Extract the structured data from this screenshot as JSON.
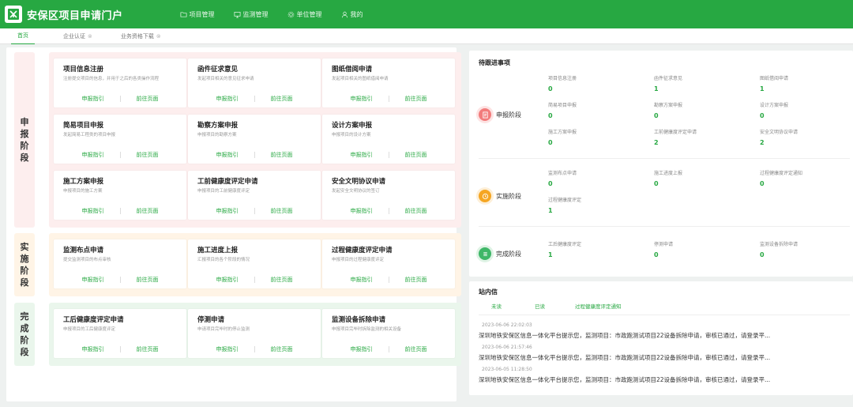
{
  "header": {
    "title": "安保区项目申请门户",
    "nav": [
      {
        "label": "项目管理",
        "icon": "folder-icon"
      },
      {
        "label": "监测管理",
        "icon": "monitor-icon"
      },
      {
        "label": "单位管理",
        "icon": "gear-icon"
      },
      {
        "label": "我的",
        "icon": "user-icon"
      }
    ]
  },
  "tabs": [
    {
      "label": "首页",
      "active": true
    },
    {
      "label": "企业认证",
      "active": false
    },
    {
      "label": "业务资格下载",
      "active": false
    }
  ],
  "card_actions": {
    "guide": "申报指引",
    "go": "前往页面"
  },
  "stages": [
    {
      "label": [
        "申",
        "报",
        "阶",
        "段"
      ],
      "cards": [
        {
          "title": "项目信息注册",
          "desc": "注册提交项目的信息，并用于之后的各类操作流程"
        },
        {
          "title": "函件征求意见",
          "desc": "发起项目相关的意见征求申请"
        },
        {
          "title": "图纸借阅申请",
          "desc": "发起项目相关的图纸借阅申请"
        },
        {
          "title": "简易项目申报",
          "desc": "发起简易工程类的项目申报"
        },
        {
          "title": "勘察方案申报",
          "desc": "申报项目的勘察方案"
        },
        {
          "title": "设计方案申报",
          "desc": "申报项目的设计方案"
        },
        {
          "title": "施工方案申报",
          "desc": "申报项目的施工方案"
        },
        {
          "title": "工前健康度评定申请",
          "desc": "申报项目的工前健康度评定"
        },
        {
          "title": "安全文明协议申请",
          "desc": "发起安全文明协议的签订"
        }
      ]
    },
    {
      "label": [
        "实",
        "施",
        "阶",
        "段"
      ],
      "cards": [
        {
          "title": "监测布点申请",
          "desc": "提交监测项目的布点审核"
        },
        {
          "title": "施工进度上报",
          "desc": "汇报项目的各个阶段的情况"
        },
        {
          "title": "过程健康度评定申请",
          "desc": "申报项目的过程健康度评定"
        }
      ]
    },
    {
      "label": [
        "完",
        "成",
        "阶",
        "段"
      ],
      "cards": [
        {
          "title": "工后健康度评定申请",
          "desc": "申报项目的工后健康度评定"
        },
        {
          "title": "停测申请",
          "desc": "申请项目完毕时的停止监测"
        },
        {
          "title": "监测设备拆除申请",
          "desc": "申报项目完毕时拆除监测的相关设备"
        }
      ]
    }
  ],
  "pending": {
    "title": "待跟进事项",
    "phases": [
      {
        "label": "申报阶段",
        "color": "#f27c7c",
        "bg": "#fde3e3",
        "items": [
          {
            "label": "项目信息注册",
            "value": "0"
          },
          {
            "label": "函件征求意见",
            "value": "1"
          },
          {
            "label": "图纸借阅申请",
            "value": "1"
          },
          {
            "label": "简易项目申报",
            "value": "0"
          },
          {
            "label": "勘察方案申报",
            "value": "0"
          },
          {
            "label": "设计方案申报",
            "value": "0"
          },
          {
            "label": "施工方案申报",
            "value": "0"
          },
          {
            "label": "工前健康度评定申请",
            "value": "2"
          },
          {
            "label": "安全文明协议申请",
            "value": "2"
          }
        ]
      },
      {
        "label": "实施阶段",
        "color": "#f5a623",
        "bg": "#fdefd8",
        "items": [
          {
            "label": "监测布点申请",
            "value": "0"
          },
          {
            "label": "施工进度上报",
            "value": "0"
          },
          {
            "label": "过程健康度评定通知",
            "value": "0"
          },
          {
            "label": "过程健康度评定",
            "value": "1"
          }
        ]
      },
      {
        "label": "完成阶段",
        "color": "#3fb768",
        "bg": "#dff3e5",
        "items": [
          {
            "label": "工后健康度评定",
            "value": "1"
          },
          {
            "label": "停测申请",
            "value": "0"
          },
          {
            "label": "监测设备拆除申请",
            "value": "0"
          }
        ]
      }
    ]
  },
  "messages": {
    "title": "站内信",
    "tabs": [
      "未读",
      "已读",
      "过程健康度评定通知"
    ],
    "items": [
      {
        "time": "2023-06-06 22:02:03",
        "text": "深圳地铁安保区信息一体化平台提示您，监测项目：市政跑测试项目22设备拆除申请，审核已通过，请登录平..."
      },
      {
        "time": "2023-06-06 21:57:46",
        "text": "深圳地铁安保区信息一体化平台提示您，监测项目：市政跑测试项目22设备拆除申请，审核已通过，请登录平..."
      },
      {
        "time": "2023-06-05 11:28:50",
        "text": "深圳地铁安保区信息一体化平台提示您，监测项目：市政跑测试项目22设备拆除申请，审核已通过，请登录平..."
      }
    ]
  },
  "colors": {
    "brand": "#27a842"
  }
}
